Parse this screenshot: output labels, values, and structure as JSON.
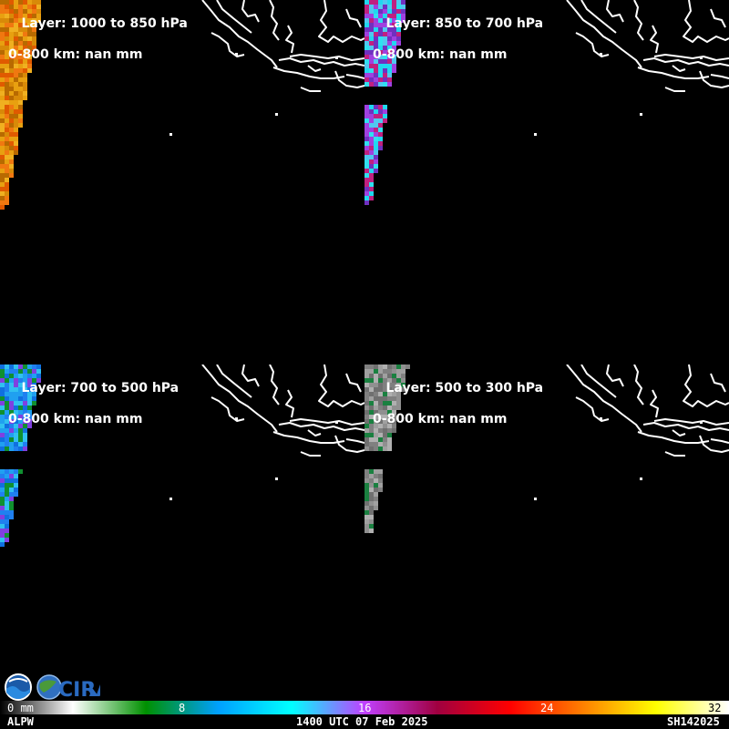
{
  "panels": [
    {
      "layer": "Layer: 1000 to 850 hPa",
      "stat": "0-800 km: nan mm",
      "palette": [
        "#e05a00",
        "#f07810",
        "#e8a010",
        "#d88a08",
        "#f0b020",
        "#b86a00"
      ]
    },
    {
      "layer": "Layer: 850 to 700 hPa",
      "stat": "0-800 km: nan mm",
      "palette": [
        "#20d8f0",
        "#50c8f0",
        "#a040e0",
        "#7030c0",
        "#c02080",
        "#30e0f0"
      ]
    },
    {
      "layer": "Layer: 700 to 500 hPa",
      "stat": "0-800 km: nan mm",
      "palette": [
        "#109030",
        "#20a0f0",
        "#1070e0",
        "#8040e0",
        "#30c0f0",
        "#2080f0"
      ]
    },
    {
      "layer": "Layer: 500 to 300 hPa",
      "stat": "0-800 km: nan mm",
      "palette": [
        "#707070",
        "#909090",
        "#a0a0a0",
        "#808080",
        "#1a8040",
        "#b0b0b0"
      ]
    }
  ],
  "colorbar": {
    "labels": [
      "0 mm",
      "8",
      "16",
      "24",
      "32"
    ],
    "label_colors": [
      "#ffffff",
      "#ffffff",
      "#ffffff",
      "#ffffff",
      "#000000"
    ],
    "stops": [
      "#000000",
      "#ffffff",
      "#009000",
      "#00a0ff",
      "#00ffff",
      "#c040ff",
      "#a00040",
      "#ff0000",
      "#ff8000",
      "#ffff00",
      "#ffffff"
    ]
  },
  "footer": {
    "product": "ALPW",
    "time": "1400 UTC 07 Feb 2025",
    "id": "SH142025"
  },
  "logos": {
    "noaa_icon": "noaa-logo-icon",
    "cira_icon": "cira-logo-icon",
    "cira_text": "CIRA"
  }
}
